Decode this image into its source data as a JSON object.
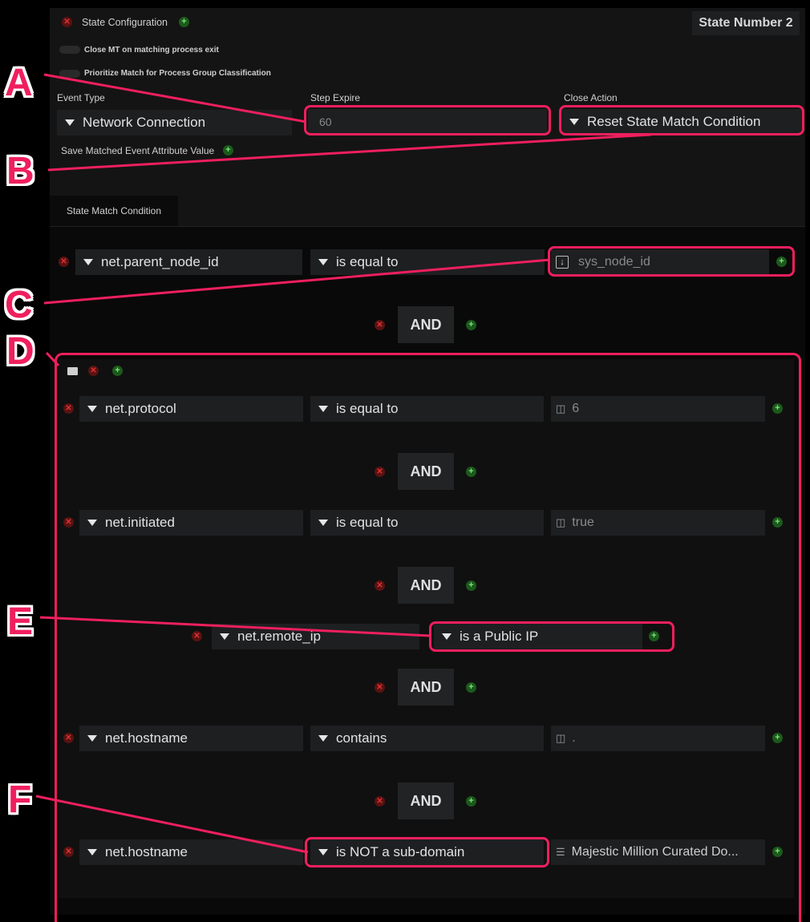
{
  "header": {
    "title": "State Configuration",
    "state_number": "State Number 2",
    "toggle_close_mt": "Close MT on matching process exit",
    "toggle_prioritize": "Prioritize Match for Process Group Classification"
  },
  "fields": {
    "event_type_label": "Event Type",
    "event_type_value": "Network Connection",
    "step_expire_label": "Step Expire",
    "step_expire_value": "60",
    "close_action_label": "Close Action",
    "close_action_value": "Reset State Match Condition",
    "save_attr_label": "Save Matched Event Attribute Value"
  },
  "tab": "State Match Condition",
  "conditions": {
    "c0": {
      "field": "net.parent_node_id",
      "op": "is equal to",
      "value": "sys_node_id"
    },
    "c1": {
      "field": "net.protocol",
      "op": "is equal to",
      "value": "6"
    },
    "c2": {
      "field": "net.initiated",
      "op": "is equal to",
      "value": "true"
    },
    "c3": {
      "field": "net.remote_ip",
      "op": "is a Public IP"
    },
    "c4": {
      "field": "net.hostname",
      "op": "contains",
      "value": "."
    },
    "c5": {
      "field": "net.hostname",
      "op": "is NOT a sub-domain",
      "value": "Majestic Million Curated Do..."
    }
  },
  "and_label": "AND",
  "callouts": [
    "A",
    "B",
    "C",
    "D",
    "E",
    "F"
  ],
  "colors": {
    "highlight": "#ef1f5e",
    "background": "#000000",
    "panel": "#141414",
    "control": "#1e1f21"
  }
}
